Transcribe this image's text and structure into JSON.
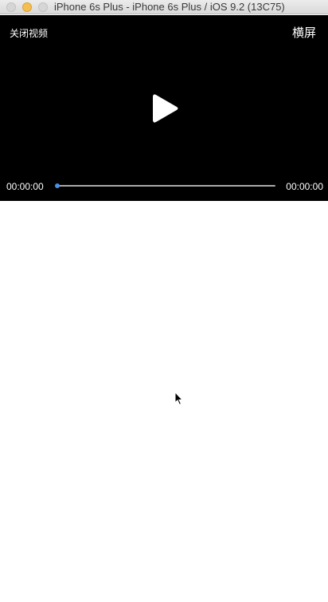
{
  "window": {
    "title": "iPhone 6s Plus - iPhone 6s Plus / iOS 9.2 (13C75)"
  },
  "player": {
    "close_label": "关闭视频",
    "landscape_label": "横屏",
    "current_time": "00:00:00",
    "total_time": "00:00:00",
    "progress": 0,
    "play_icon": "play-icon"
  },
  "colors": {
    "player_background": "#000000",
    "progress_accent": "#4a90e2",
    "track": "#a9a9a9"
  }
}
